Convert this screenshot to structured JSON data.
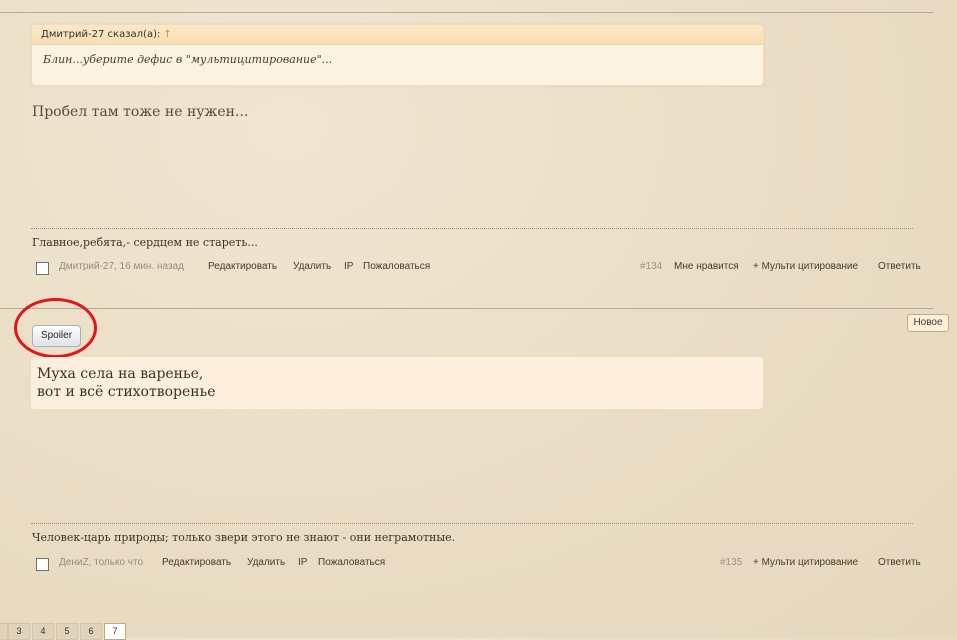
{
  "post1": {
    "quote_author": "Дмитрий-27 сказал(а):",
    "quote_arrow": "↑",
    "quote_text": "Блин...уберите дефис в \"мультицитирование\"...",
    "body": "Пробел там тоже не нужен...",
    "signature": "Главное,ребята,- сердцем не стареть...",
    "author": "Дмитрий-27, 16 мин. назад",
    "links": {
      "edit": "Редактировать",
      "delete": "Удалить",
      "ip": "IP",
      "report": "Пожаловаться"
    },
    "post_number": "#134",
    "like": "Мне нравится",
    "multiquote": "+ Мульти цитирование",
    "reply": "Ответить"
  },
  "post2": {
    "new_badge": "Новое",
    "spoiler_label": "Spoiler",
    "body_line1": "Муха села на варенье,",
    "body_line2": "вот и всё стихотворенье",
    "signature": "Человек-царь природы; только звери этого не знают - они неграмотные.",
    "author": "ДениZ, только что",
    "links": {
      "edit": "Редактировать",
      "delete": "Удалить",
      "ip": "IP",
      "report": "Пожаловаться"
    },
    "post_number": "#135",
    "multiquote": "+ Мульти цитирование",
    "reply": "Ответить"
  },
  "pagination": [
    "3",
    "4",
    "5",
    "6",
    "7"
  ],
  "current_page": "7",
  "colors": {
    "highlight_circle": "#e0161b",
    "quote_bg": "#fdf3e3",
    "page_bg": "#ede0c8"
  }
}
